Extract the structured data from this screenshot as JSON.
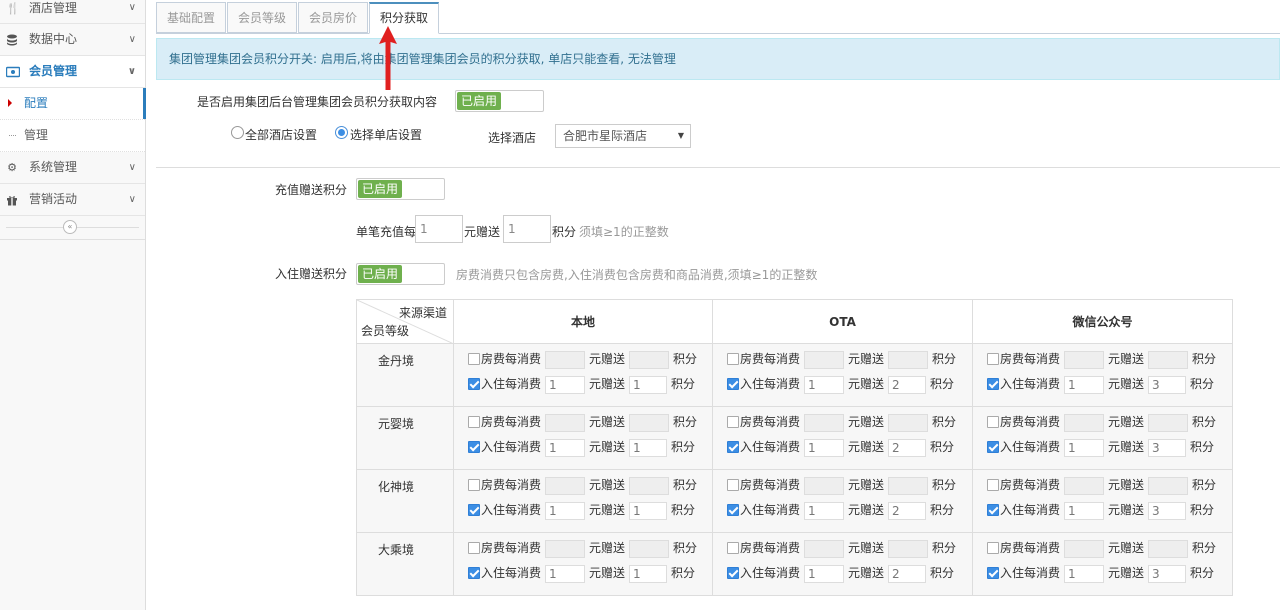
{
  "sidebar": {
    "items": [
      {
        "label": "酒店管理",
        "icon": "cutlery-icon",
        "expanded": false
      },
      {
        "label": "数据中心",
        "icon": "database-icon",
        "expanded": false
      },
      {
        "label": "会员管理",
        "icon": "member-card-icon",
        "expanded": true
      },
      {
        "label": "系统管理",
        "icon": "gear-icon",
        "expanded": false
      },
      {
        "label": "营销活动",
        "icon": "gift-icon",
        "expanded": false
      }
    ],
    "subitems": [
      {
        "label": "配置",
        "active": true
      },
      {
        "label": "管理",
        "active": false
      }
    ],
    "collapse_icon": "double-chevron-left-icon"
  },
  "tabs": [
    {
      "label": "基础配置",
      "active": false
    },
    {
      "label": "会员等级",
      "active": false
    },
    {
      "label": "会员房价",
      "active": false
    },
    {
      "label": "积分获取",
      "active": true
    }
  ],
  "info": {
    "text": "集团管理集团会员积分开关: 启用后,将由集团管理集团会员的积分获取, 单店只能查看, 无法管理"
  },
  "group_switch": {
    "label": "是否启用集团后台管理集团会员积分获取内容",
    "toggle_label": "已启用",
    "scope_options": [
      {
        "label": "全部酒店设置",
        "checked": false
      },
      {
        "label": "选择单店设置",
        "checked": true
      }
    ],
    "hotel_label": "选择酒店",
    "hotel_value": "合肥市星际酒店"
  },
  "recharge": {
    "label": "充值赠送积分",
    "toggle_label": "已启用",
    "prefix": "单笔充值每",
    "amount": "1",
    "mid": "元赠送",
    "points": "1",
    "suffix": "积分",
    "hint": "须填≥1的正整数"
  },
  "stay": {
    "label": "入住赠送积分",
    "toggle_label": "已启用",
    "hint": "房费消费只包含房费,入住消费包含房费和商品消费,须填≥1的正整数"
  },
  "table": {
    "corner_top": "来源渠道",
    "corner_bottom": "会员等级",
    "channels": [
      "本地",
      "OTA",
      "微信公众号"
    ],
    "row1_label": "房费每消费",
    "row2_label": "入住每消费",
    "mid_label": "元赠送",
    "unit_label": "积分",
    "levels": [
      {
        "name": "金丹境",
        "channels": [
          {
            "room_amount": "",
            "room_points": "",
            "stay_amount": "1",
            "stay_points": "1"
          },
          {
            "room_amount": "",
            "room_points": "",
            "stay_amount": "1",
            "stay_points": "2"
          },
          {
            "room_amount": "",
            "room_points": "",
            "stay_amount": "1",
            "stay_points": "3"
          }
        ]
      },
      {
        "name": "元婴境",
        "channels": [
          {
            "room_amount": "",
            "room_points": "",
            "stay_amount": "1",
            "stay_points": "1"
          },
          {
            "room_amount": "",
            "room_points": "",
            "stay_amount": "1",
            "stay_points": "2"
          },
          {
            "room_amount": "",
            "room_points": "",
            "stay_amount": "1",
            "stay_points": "3"
          }
        ]
      },
      {
        "name": "化神境",
        "channels": [
          {
            "room_amount": "",
            "room_points": "",
            "stay_amount": "1",
            "stay_points": "1"
          },
          {
            "room_amount": "",
            "room_points": "",
            "stay_amount": "1",
            "stay_points": "2"
          },
          {
            "room_amount": "",
            "room_points": "",
            "stay_amount": "1",
            "stay_points": "3"
          }
        ]
      },
      {
        "name": "大乘境",
        "channels": [
          {
            "room_amount": "",
            "room_points": "",
            "stay_amount": "1",
            "stay_points": "1"
          },
          {
            "room_amount": "",
            "room_points": "",
            "stay_amount": "1",
            "stay_points": "2"
          },
          {
            "room_amount": "",
            "room_points": "",
            "stay_amount": "1",
            "stay_points": "3"
          }
        ]
      }
    ]
  },
  "colors": {
    "accent": "#2b7dbc",
    "toggle_on": "#6fb04e",
    "info_bg": "#d9edf7",
    "info_text": "#31708f",
    "annotation_arrow": "#e02020"
  },
  "annotation_icon": "red-up-arrow-icon"
}
